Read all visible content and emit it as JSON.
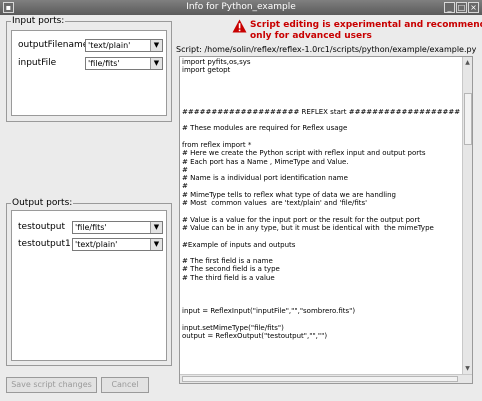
{
  "window": {
    "title": "Info for Python_example"
  },
  "input_ports": {
    "group_title": "Input ports:",
    "rows": [
      {
        "name": "outputFilename",
        "mime": "'text/plain'"
      },
      {
        "name": "inputFile",
        "mime": "'file/fits'"
      }
    ]
  },
  "output_ports": {
    "group_title": "Output ports:",
    "rows": [
      {
        "name": "testoutput",
        "mime": "'file/fits'"
      },
      {
        "name": "testoutput1",
        "mime": "'text/plain'"
      }
    ]
  },
  "warning": {
    "line1": "Script editing is experimental and recommended",
    "line2": "only for advanced users",
    "color": "#c80000"
  },
  "script": {
    "label": "Script: /home/solin/reflex/reflex-1.0rc1/scripts/python/example/example.py",
    "code": "import pyfits,os,sys\nimport getopt\n\n\n\n\n#################### REFLEX start ######################\n\n# These modules are required for Reflex usage\n\nfrom reflex import *\n# Here we create the Python script with reflex input and output ports\n# Each port has a Name , MimeType and Value.\n#\n# Name is a individual port identification name\n#\n# MimeType tells to reflex what type of data we are handling\n# Most  common values  are 'text/plain' and 'file/fits'\n\n# Value is a value for the input port or the result for the output port\n# Value can be in any type, but it must be identical with  the mimeType\n\n#Example of inputs and outputs\n\n# The first field is a name\n# The second field is a type\n# The third field is a value\n\n\n\ninput = ReflexInput(\"inputFile\",\"\",\"sombrero.fits\")\n\ninput.setMimeType(\"file/fits\")\noutput = ReflexOutput(\"testoutput\",\"\",\"\")"
  },
  "buttons": {
    "save": "Save script changes",
    "cancel": "Cancel"
  }
}
